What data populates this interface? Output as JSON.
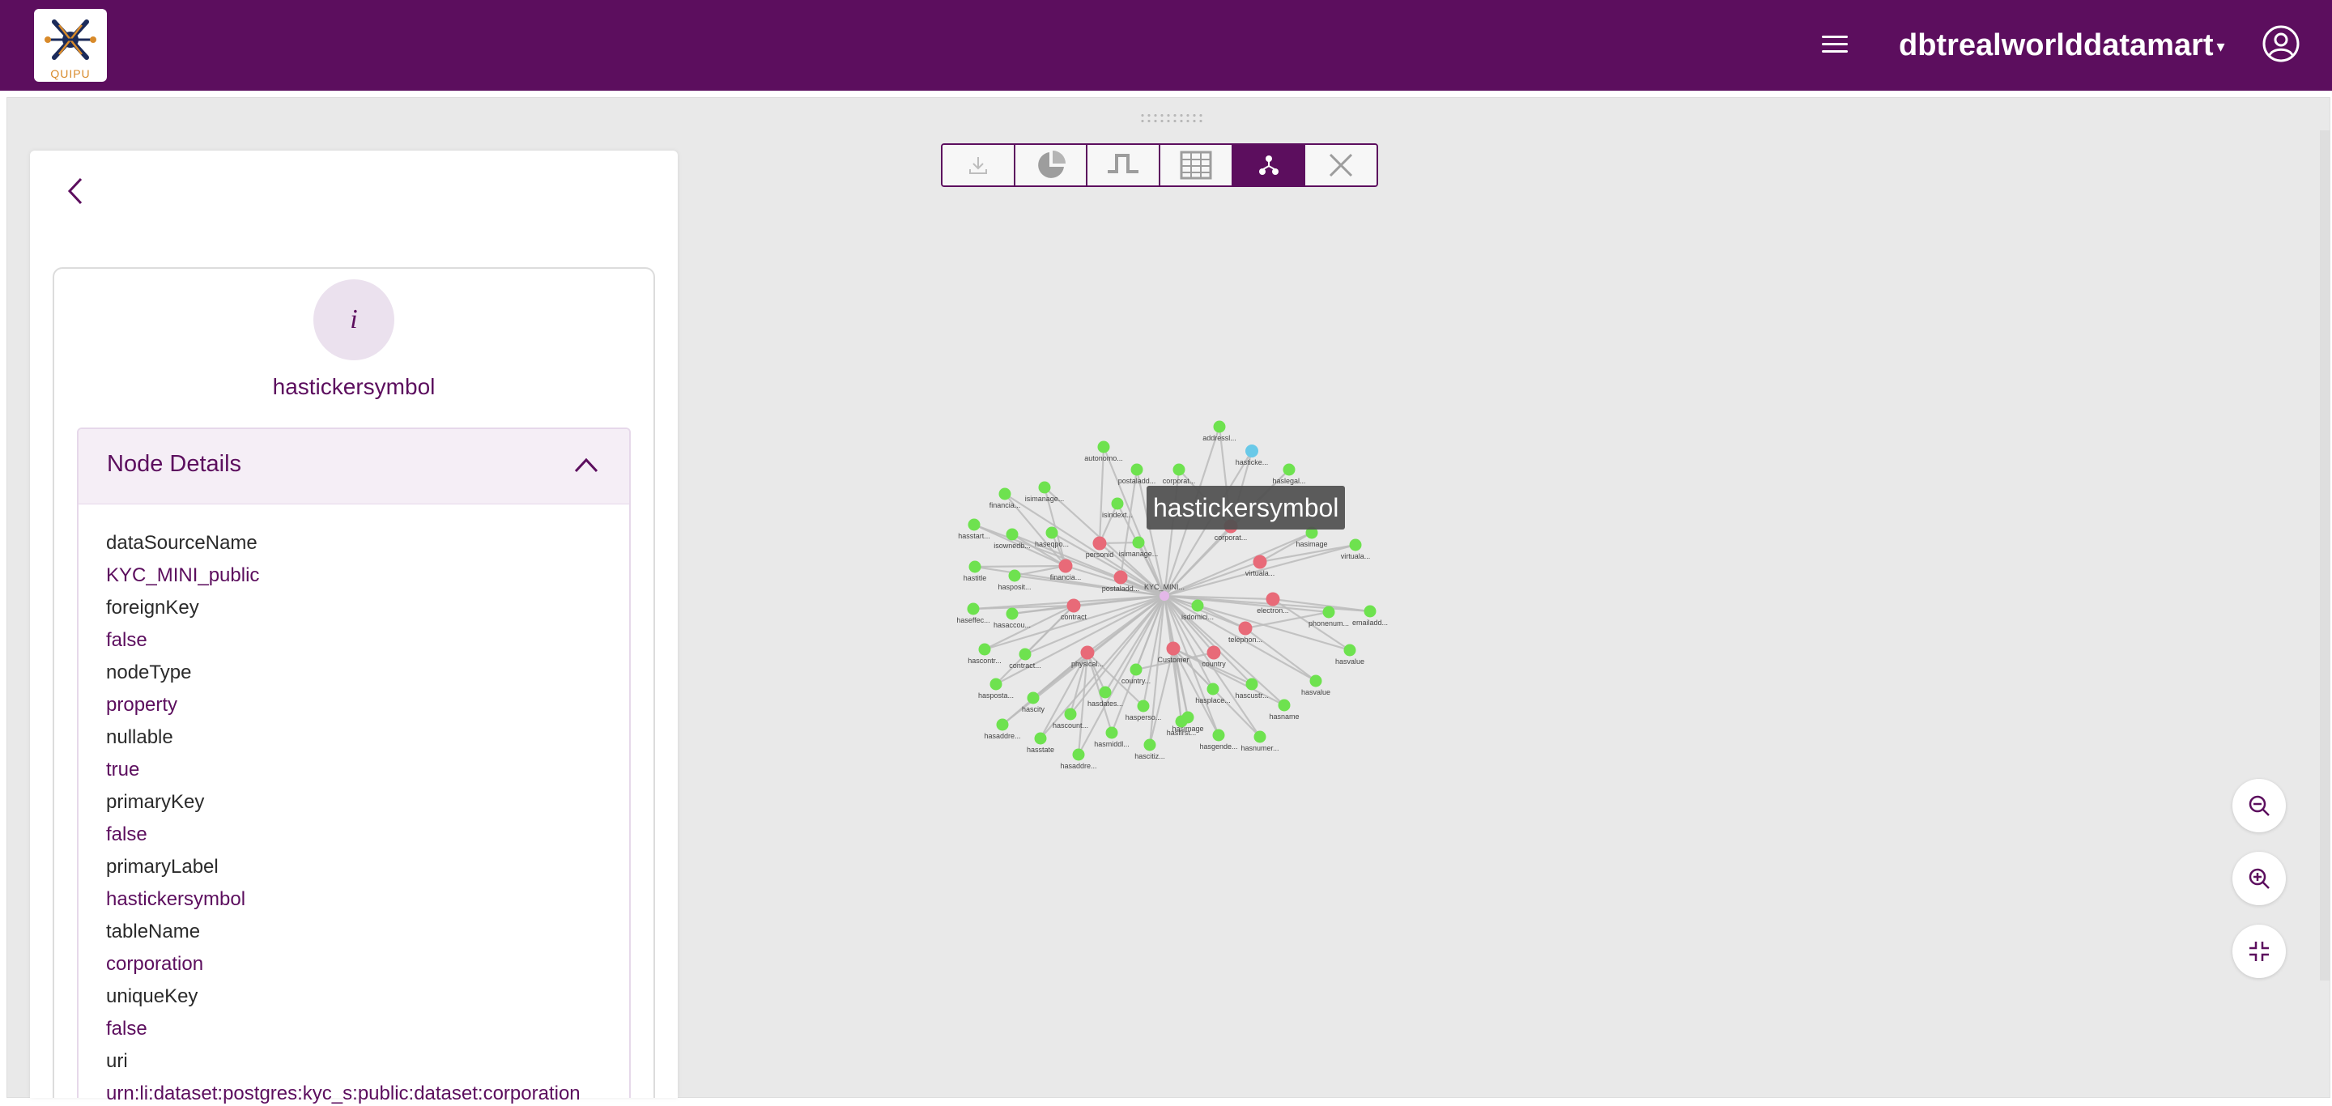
{
  "header": {
    "logo_text": "QUIPU",
    "database_name": "dbtrealworlddatamart",
    "database_caret": "▾",
    "menu_icon": "hamburger-icon",
    "user_icon": "user-circle-icon"
  },
  "toolbar": {
    "buttons": [
      {
        "icon": "download-icon",
        "active": false
      },
      {
        "icon": "pie-chart-icon",
        "active": false
      },
      {
        "icon": "lineage-step-icon",
        "active": false
      },
      {
        "icon": "table-icon",
        "active": false
      },
      {
        "icon": "graph-icon",
        "active": true
      },
      {
        "icon": "close-icon",
        "active": false
      }
    ]
  },
  "side_panel": {
    "back_icon": "chevron-left-icon",
    "info_icon_text": "i",
    "node_name": "hastickersymbol",
    "details_title": "Node Details",
    "details": [
      {
        "key": "dataSourceName",
        "value": "KYC_MINI_public"
      },
      {
        "key": "foreignKey",
        "value": "false"
      },
      {
        "key": "nodeType",
        "value": "property"
      },
      {
        "key": "nullable",
        "value": "true"
      },
      {
        "key": "primaryKey",
        "value": "false"
      },
      {
        "key": "primaryLabel",
        "value": "hastickersymbol"
      },
      {
        "key": "tableName",
        "value": "corporation"
      },
      {
        "key": "uniqueKey",
        "value": "false"
      },
      {
        "key": "uri",
        "value": "urn:li:dataset:postgres:kyc_s:public:dataset:corporation"
      }
    ]
  },
  "graph": {
    "tooltip": "hastickersymbol",
    "center_label": "KYC_MINI...",
    "colors": {
      "property": "#6ee24f",
      "table": "#e86a78",
      "center": "#e3b8e8",
      "selected": "#69c9e8",
      "edge": "#bcbcbc"
    },
    "tables": [
      "corporat...",
      "virtuala...",
      "electron...",
      "telephon...",
      "Customer",
      "country",
      "physical...",
      "contract",
      "financia...",
      "postaladd...",
      "personid"
    ],
    "properties": [
      "addressl...",
      "hasticke...",
      "haslegal...",
      "hasimage",
      "virtuala...",
      "emailadd...",
      "hasvalue",
      "phonenum...",
      "hasvalue",
      "hasname",
      "hascustr...",
      "hasplace...",
      "hasgende...",
      "hasnumer...",
      "hasimage",
      "hasfirst...",
      "hascitiz...",
      "hasperso...",
      "hasmiddl...",
      "hasaddre...",
      "hasdates...",
      "hascount...",
      "hasstate",
      "hascity",
      "hasaddre...",
      "haspostа...",
      "hascontr...",
      "contract...",
      "hasaccou...",
      "haseffec...",
      "hasposit...",
      "hastitle",
      "hasstart...",
      "isownedb...",
      "haseqpo...",
      "isimanage...",
      "financia...",
      "autonomo...",
      "postaladd...",
      "corporat...",
      "isindext...",
      "isimanage...",
      "country...",
      "isdomici..."
    ]
  },
  "zoom": {
    "zoom_out_icon": "zoom-out-icon",
    "zoom_in_icon": "zoom-in-icon",
    "fit_icon": "fit-screen-icon"
  }
}
